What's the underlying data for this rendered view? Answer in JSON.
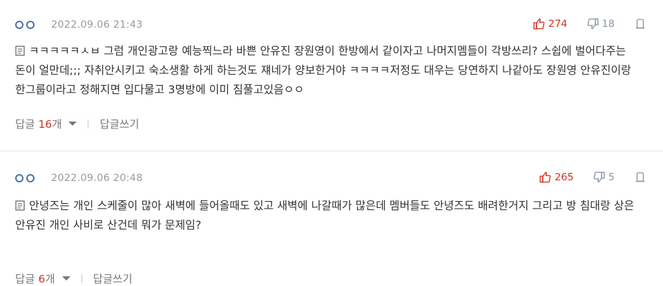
{
  "comments": [
    {
      "date": "2022.09.06 21:43",
      "upvotes": "274",
      "downvotes": "18",
      "text": "ㅋㅋㅋㅋㅋㅅㅂ 그럼 개인광고랑 예능찍느라 바쁜 안유진 장원영이 한방에서 같이자고 나머지멤들이 각방쓰리? 스쉽에 벌어다주는 돈이 얼만데;;; 자취안시키고 숙소생활 하게 하는것도 쟤네가 양보한거야 ㅋㅋㅋㅋ저정도 대우는 당연하지 나같아도 장원영 안유진이랑 한그룹이라고 정해지면 입다물고 3명방에 이미 짐풀고있음ㅇㅇ",
      "reply_label": "답글 ",
      "reply_count": "16",
      "reply_unit": "개",
      "write_reply": "답글쓰기"
    },
    {
      "date": "2022.09.06 20:48",
      "upvotes": "265",
      "downvotes": "5",
      "text": "안녕즈는 개인 스케줄이 많아 새벽에 들어올때도 있고 새벽에 나갈때가 많은데 멤버들도 안녕즈도 배려한거지 그리고 방 침대랑 상은 안유진 개인 사비로 산건데 뭐가 문제임?",
      "reply_label": "답글 ",
      "reply_count": "6",
      "reply_unit": "개",
      "write_reply": "답글쓰기"
    }
  ],
  "icons": {
    "user": "user-dots-icon",
    "upvote": "thumbs-up-icon",
    "downvote": "thumbs-down-icon",
    "report": "report-icon",
    "comment_doc": "document-icon",
    "dropdown": "caret-down-icon"
  },
  "colors": {
    "accent_red": "#d0321e",
    "user_blue": "#4a6fa5",
    "muted_gray": "#9a9a9a",
    "downvote_gray": "#8a96a8"
  }
}
